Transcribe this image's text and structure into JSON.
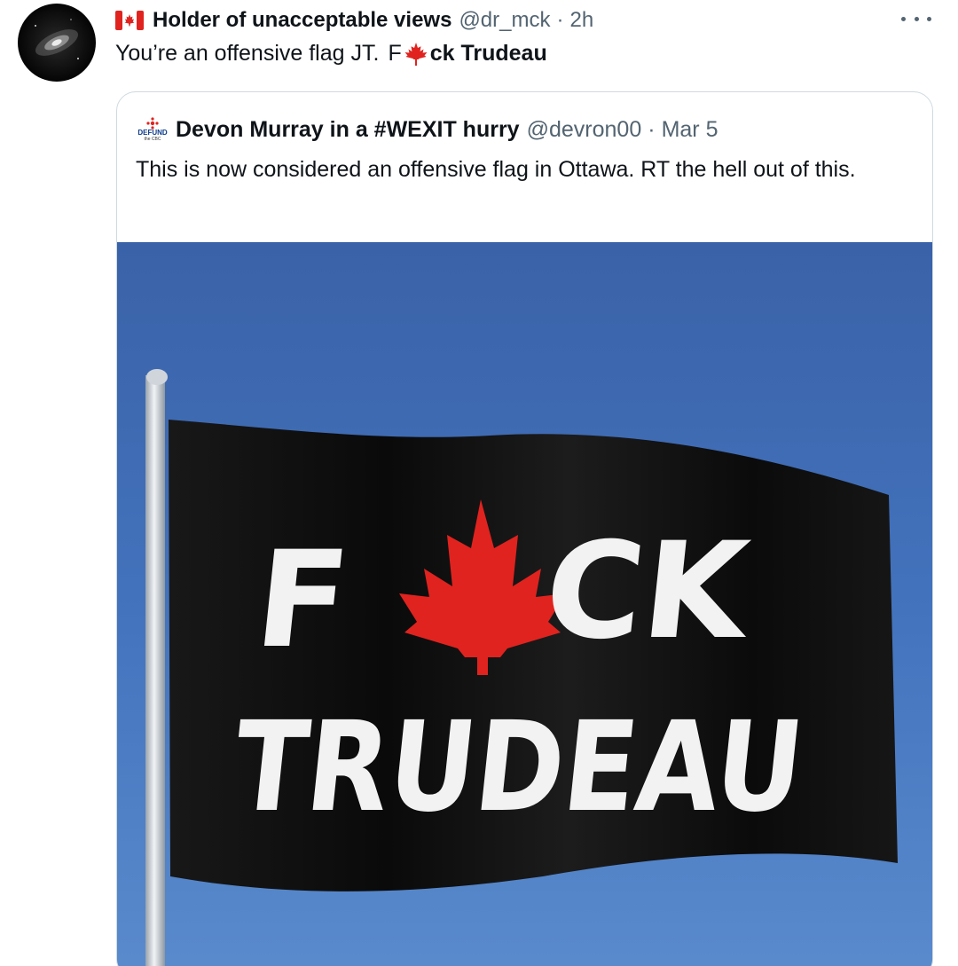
{
  "tweet": {
    "author_flag_icon": "canada-flag-emoji",
    "display_name": "Holder of unacceptable views",
    "handle": "@dr_mck",
    "separator": "·",
    "time": "2h",
    "text_prefix": "You’re an offensive flag JT.",
    "text_f": "F",
    "text_leaf_icon": "maple-leaf-emoji",
    "text_rest": "ck Trudeau",
    "more_icon": "more-horizontal-icon"
  },
  "quoted": {
    "avatar_text_main": "DEFUND",
    "avatar_text_sub": "the CBC",
    "display_name": "Devon Murray in a #WEXIT hurry",
    "handle": "@devron00",
    "separator": "·",
    "date": "Mar 5",
    "text": "This is now considered an offensive flag in Ottawa. RT the hell out of this.",
    "image": {
      "line1_f": "F",
      "line1_rest": "CK",
      "line2": "TRUDEAU",
      "leaf_color": "#e0231f",
      "flag_color": "#111111",
      "sky_color": "#3f6fb8"
    }
  },
  "colors": {
    "text_primary": "#0f1419",
    "text_secondary": "#536471",
    "border": "#cfd9de"
  }
}
